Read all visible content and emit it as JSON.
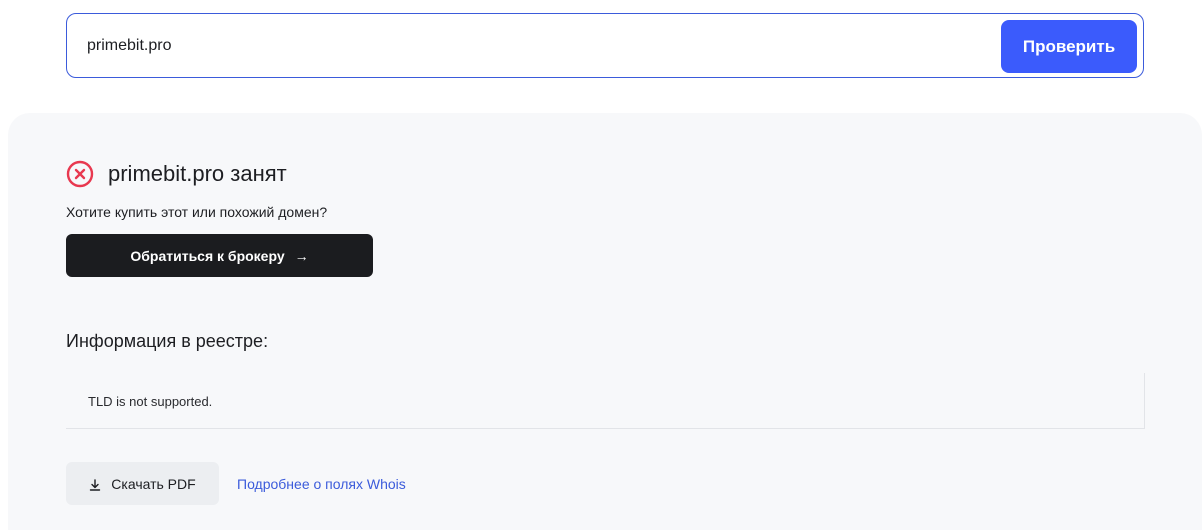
{
  "search": {
    "value": "primebit.pro",
    "button_label": "Проверить"
  },
  "result": {
    "status_text": "primebit.pro занят",
    "subtitle": "Хотите купить этот или похожий домен?",
    "broker_button_label": "Обратиться к брокеру",
    "broker_arrow": "→"
  },
  "registry": {
    "title": "Информация в реестре:",
    "text": "TLD is not supported."
  },
  "actions": {
    "pdf_label": "Скачать PDF",
    "whois_link": "Подробнее о полях Whois"
  },
  "icons": {
    "status": "close-circle-icon",
    "download": "download-icon"
  },
  "colors": {
    "accent": "#3b5bfc",
    "status_error": "#e8384f",
    "dark_button": "#1b1c1f",
    "panel_bg": "#f7f8fa",
    "link": "#3b5bdb"
  }
}
